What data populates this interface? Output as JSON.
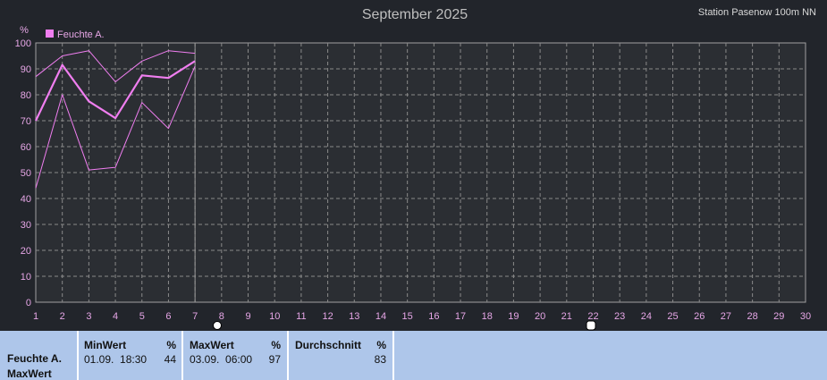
{
  "header": {
    "title": "September 2025",
    "station": "Station Pasenow 100m NN"
  },
  "chart_data": {
    "type": "line",
    "title": "September 2025",
    "ylabel": "%",
    "ylim": [
      0,
      100
    ],
    "yticks": [
      0,
      10,
      20,
      30,
      40,
      50,
      60,
      70,
      80,
      90,
      100
    ],
    "xlim": [
      1,
      30
    ],
    "x_ticks": [
      "1",
      "2",
      "3",
      "4",
      "5",
      "6",
      "7",
      "8",
      "9",
      "10",
      "11",
      "12",
      "13",
      "14",
      "15",
      "16",
      "17",
      "18",
      "19",
      "20",
      "21",
      "22",
      "23",
      "24",
      "25",
      "26",
      "27",
      "28",
      "29",
      "30"
    ],
    "grid": true,
    "legend": "top-left",
    "current_day_marker": 7,
    "series": [
      {
        "name": "Feuchte A.",
        "role": "mean",
        "color": "#f07ef0",
        "x": [
          1,
          2,
          3,
          4,
          5,
          6,
          7
        ],
        "values": [
          70,
          91.5,
          77.5,
          71,
          87.5,
          86.5,
          93
        ]
      },
      {
        "role": "max",
        "color": "#f07ef0",
        "x": [
          1,
          2,
          3,
          4,
          5,
          6,
          7
        ],
        "values": [
          87,
          95,
          97,
          85,
          93,
          97,
          96
        ]
      },
      {
        "role": "min",
        "color": "#f07ef0",
        "x": [
          1,
          2,
          3,
          4,
          5,
          6,
          7
        ],
        "values": [
          44,
          80,
          51,
          52,
          77,
          67,
          91
        ]
      }
    ]
  },
  "stats": {
    "row_label_1": "Feuchte A.",
    "row_label_2": "MaxWert",
    "min": {
      "header": "MinWert",
      "unit": "%",
      "datetime": "01.09.  18:30",
      "value": "44"
    },
    "max": {
      "header": "MaxWert",
      "unit": "%",
      "datetime": "03.09.  06:00",
      "value": "97"
    },
    "avg": {
      "header": "Durchschnitt",
      "unit": "%",
      "value": "83"
    }
  },
  "colors": {
    "background": "#22252b",
    "plot_background": "#2b2e33",
    "grid": "#8a8a8a",
    "axis_text": "#e6a6e6",
    "series": "#f07ef0",
    "stats_background": "#aec6ea"
  }
}
